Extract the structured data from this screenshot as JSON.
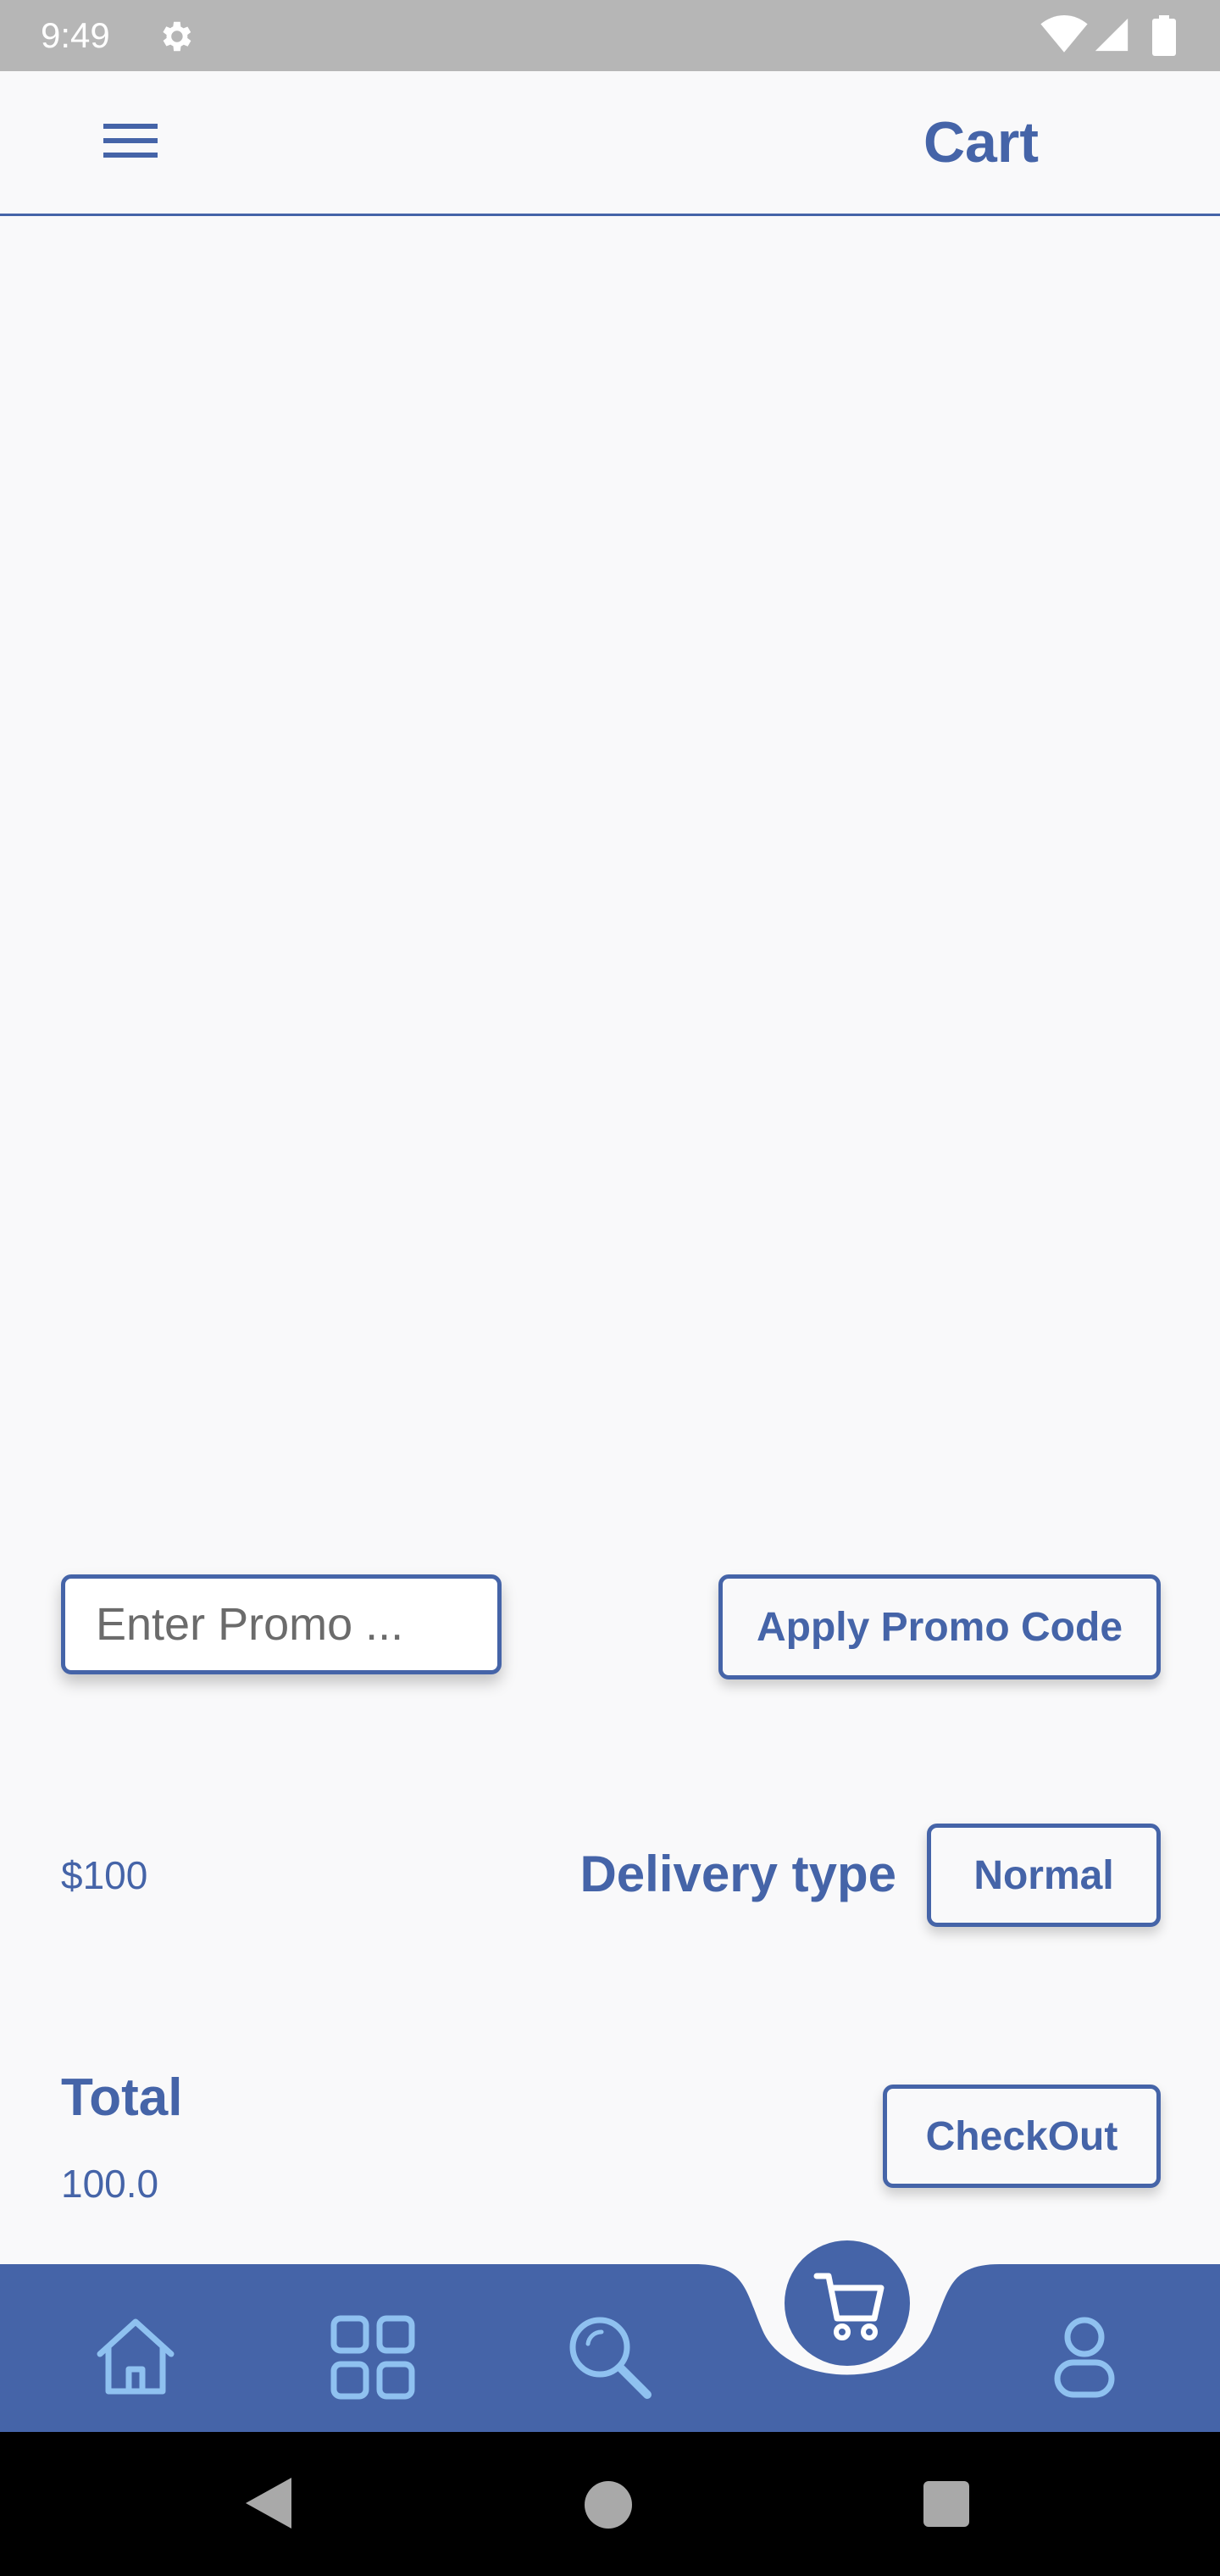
{
  "status_bar": {
    "time": "9:49",
    "icons": [
      "settings-gear-icon",
      "wifi-icon",
      "cell-signal-icon",
      "battery-icon"
    ]
  },
  "app_bar": {
    "title": "Cart",
    "menu_icon": "hamburger-menu-icon"
  },
  "promo": {
    "input_placeholder": "Enter Promo ...",
    "input_value": "",
    "apply_label": "Apply Promo Code"
  },
  "delivery": {
    "price": "$100",
    "label": "Delivery type",
    "selected_option": "Normal"
  },
  "summary": {
    "total_label": "Total",
    "total_value": "100.0",
    "checkout_label": "CheckOut"
  },
  "bottom_nav": {
    "items": [
      "home-icon",
      "categories-grid-icon",
      "search-icon",
      "cart-icon",
      "profile-icon"
    ],
    "active": "cart-icon"
  },
  "system_nav": [
    "back",
    "home",
    "recents"
  ],
  "colors": {
    "primary": "#4564a8",
    "nav_icon": "#8fc1f0",
    "background": "#f9f9fa",
    "status_bar": "#b6b6b6"
  }
}
